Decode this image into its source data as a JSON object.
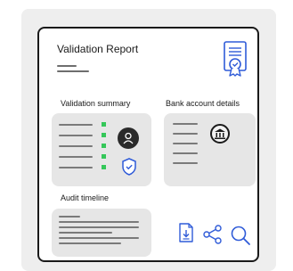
{
  "card": {
    "title": "Validation Report",
    "sections": {
      "summary_label": "Validation summary",
      "bank_label": "Bank account details",
      "audit_label": "Audit timeline"
    }
  },
  "icons": {
    "certificate": "certificate-icon",
    "user": "user-icon",
    "shield": "shield-check-icon",
    "bank": "bank-icon",
    "download": "download-document-icon",
    "share": "share-icon",
    "search": "search-icon"
  },
  "colors": {
    "accent_blue": "#2f5bd8",
    "status_green": "#34c759",
    "ink": "#1a1a1a"
  }
}
